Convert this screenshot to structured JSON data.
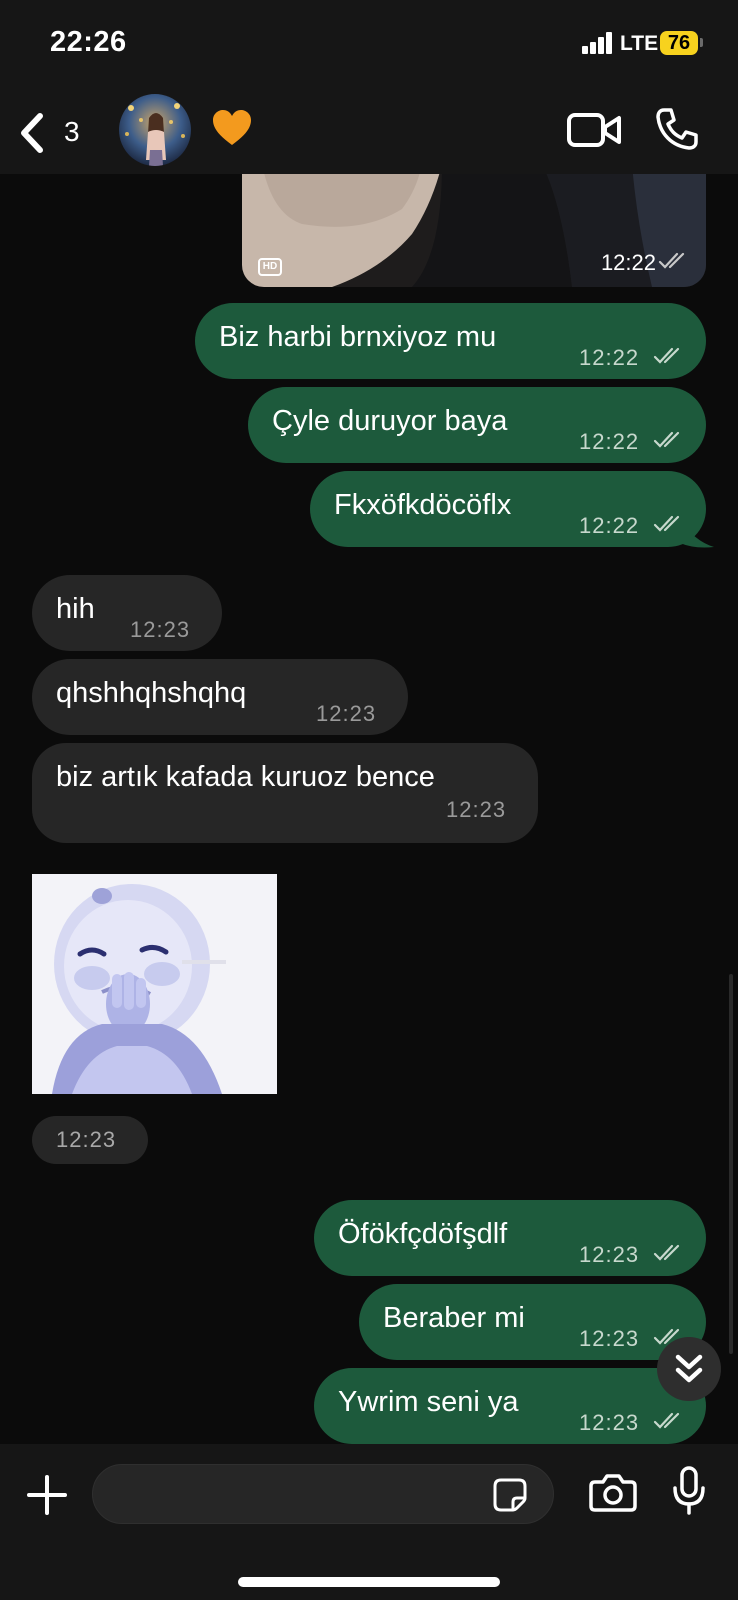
{
  "status_bar": {
    "time": "22:26",
    "network": "LTE",
    "battery": "76"
  },
  "header": {
    "back_count": "3",
    "contact_emoji": "🧡",
    "icons": [
      "chevron-left-icon",
      "video-call-icon",
      "phone-icon"
    ]
  },
  "photo": {
    "hd_label": "HD",
    "time": "12:22"
  },
  "messages": [
    {
      "direction": "out",
      "text": "Biz harbi brnxiyoz mu",
      "time": "12:22"
    },
    {
      "direction": "out",
      "text": "Çyle duruyor baya",
      "time": "12:22"
    },
    {
      "direction": "out",
      "text": "Fkxöfkdöcöflx",
      "time": "12:22"
    },
    {
      "direction": "in",
      "text": "hih",
      "time": "12:23"
    },
    {
      "direction": "in",
      "text": "qhshhqhshqhq",
      "time": "12:23"
    },
    {
      "direction": "in",
      "text": "biz artık kafada kuruoz bence",
      "time": "12:23"
    },
    {
      "direction": "out",
      "text": "Öfökfçdöfşdlf",
      "time": "12:23"
    },
    {
      "direction": "out",
      "text": "Beraber mi",
      "time": "12:23"
    },
    {
      "direction": "out",
      "text": "Ywrim seni ya",
      "time": "12:23"
    }
  ],
  "sticker": {
    "time": "12:23"
  },
  "input": {
    "placeholder": "",
    "icons": [
      "plus-icon",
      "sticker-icon",
      "camera-icon",
      "mic-icon"
    ]
  },
  "colors": {
    "outgoing_bubble": "#1d5a3c",
    "incoming_bubble": "#262626",
    "background": "#0b0b0b",
    "battery": "#f7d21e"
  }
}
